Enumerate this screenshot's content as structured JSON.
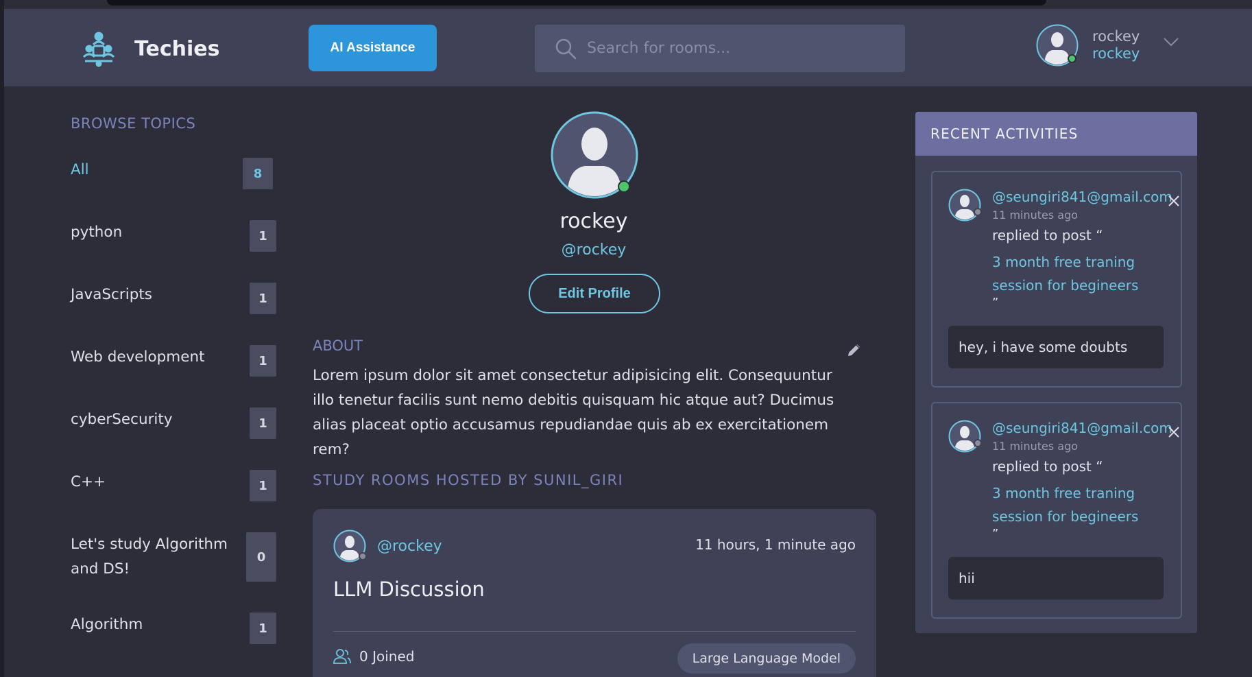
{
  "app": {
    "name": "Techies",
    "ai_button": "AI Assistance",
    "search_placeholder": "Search for rooms...",
    "user": {
      "name": "rockey",
      "username": "rockey"
    }
  },
  "sidebar": {
    "title": "BROWSE TOPICS",
    "topics": [
      {
        "name": "All",
        "count": "8",
        "active": true
      },
      {
        "name": "python",
        "count": "1"
      },
      {
        "name": "JavaScripts",
        "count": "1"
      },
      {
        "name": "Web development",
        "count": "1"
      },
      {
        "name": "cyberSecurity",
        "count": "1"
      },
      {
        "name": "C++",
        "count": "1"
      },
      {
        "name": "Let's study Algorithm and DS!",
        "count": "0"
      },
      {
        "name": "Algorithm",
        "count": "1"
      }
    ]
  },
  "profile": {
    "name": "rockey",
    "handle": "@rockey",
    "edit_label": "Edit Profile",
    "about_title": "ABOUT",
    "about_text": "Lorem ipsum dolor sit amet consectetur adipisicing elit. Consequuntur illo tenetur facilis sunt nemo debitis quisquam hic atque aut? Ducimus alias placeat optio accusamus repudiandae quis ab ex exercitationem rem?",
    "rooms_title": "STUDY ROOMS HOSTED BY SUNIL_GIRI"
  },
  "room": {
    "host": "@rockey",
    "time": "11 hours, 1 minute ago",
    "title": "LLM Discussion",
    "joined": "0 Joined",
    "topic": "Large Language Model"
  },
  "activities": {
    "title": "RECENT ACTIVITIES",
    "items": [
      {
        "user": "@seungiri841@gmail.com",
        "time": "11 minutes ago",
        "action": "replied to post “",
        "post": "3 month free traning session for begineers",
        "quote_close": "”",
        "message": "hey, i have some doubts"
      },
      {
        "user": "@seungiri841@gmail.com",
        "time": "11 minutes ago",
        "action": "replied to post “",
        "post": "3 month free traning session for begineers",
        "quote_close": "”",
        "message": "hii"
      }
    ]
  },
  "colors": {
    "accent": "#6ec6e0",
    "primary_button": "#2d95d9",
    "header_bg": "#3f4156",
    "page_bg": "#2d2d39",
    "muted_title": "#7c84bb",
    "activity_header": "#6d6fa0",
    "online": "#4cc56b"
  }
}
